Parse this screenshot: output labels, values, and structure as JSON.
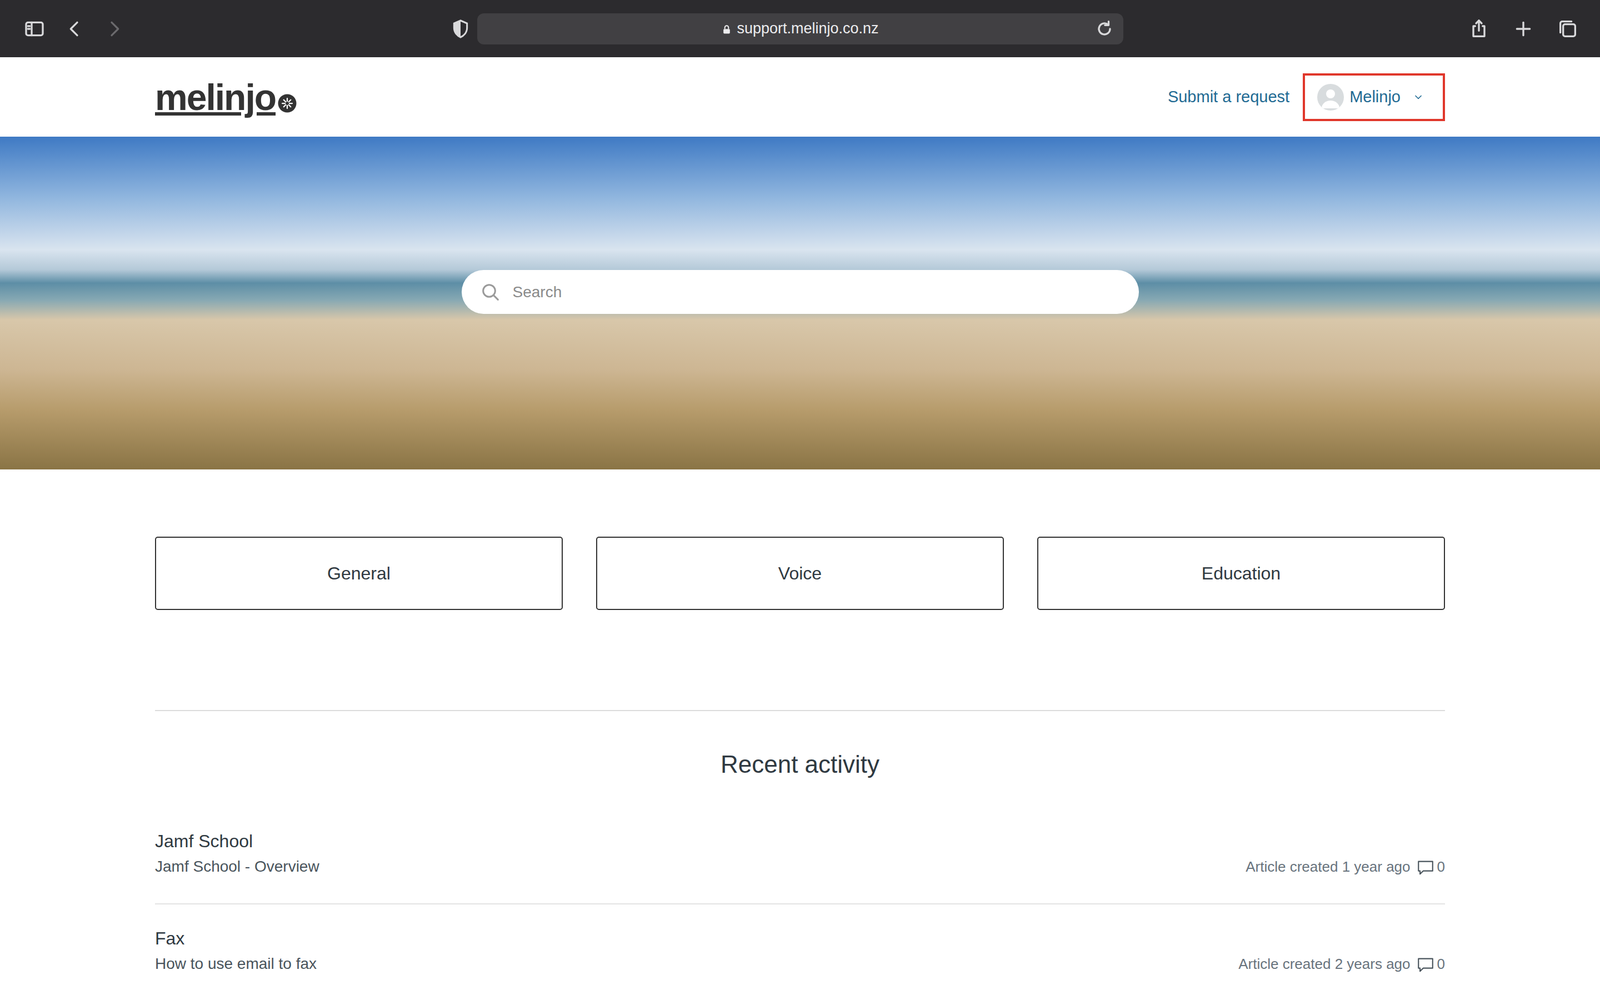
{
  "browser": {
    "url": "support.melinjo.co.nz"
  },
  "header": {
    "logo": "melinjo",
    "submit_request": "Submit a request",
    "user": {
      "name": "Melinjo",
      "highlighted": true
    }
  },
  "hero": {
    "search": {
      "placeholder": "Search"
    }
  },
  "categories": [
    {
      "label": "General"
    },
    {
      "label": "Voice"
    },
    {
      "label": "Education"
    }
  ],
  "recent_activity": {
    "title": "Recent activity",
    "items": [
      {
        "section": "Jamf School",
        "title": "Jamf School - Overview",
        "meta": "Article created 1 year ago",
        "comments": "0"
      },
      {
        "section": "Fax",
        "title": "How to use email to fax",
        "meta": "Article created 2 years ago",
        "comments": "0"
      }
    ]
  }
}
